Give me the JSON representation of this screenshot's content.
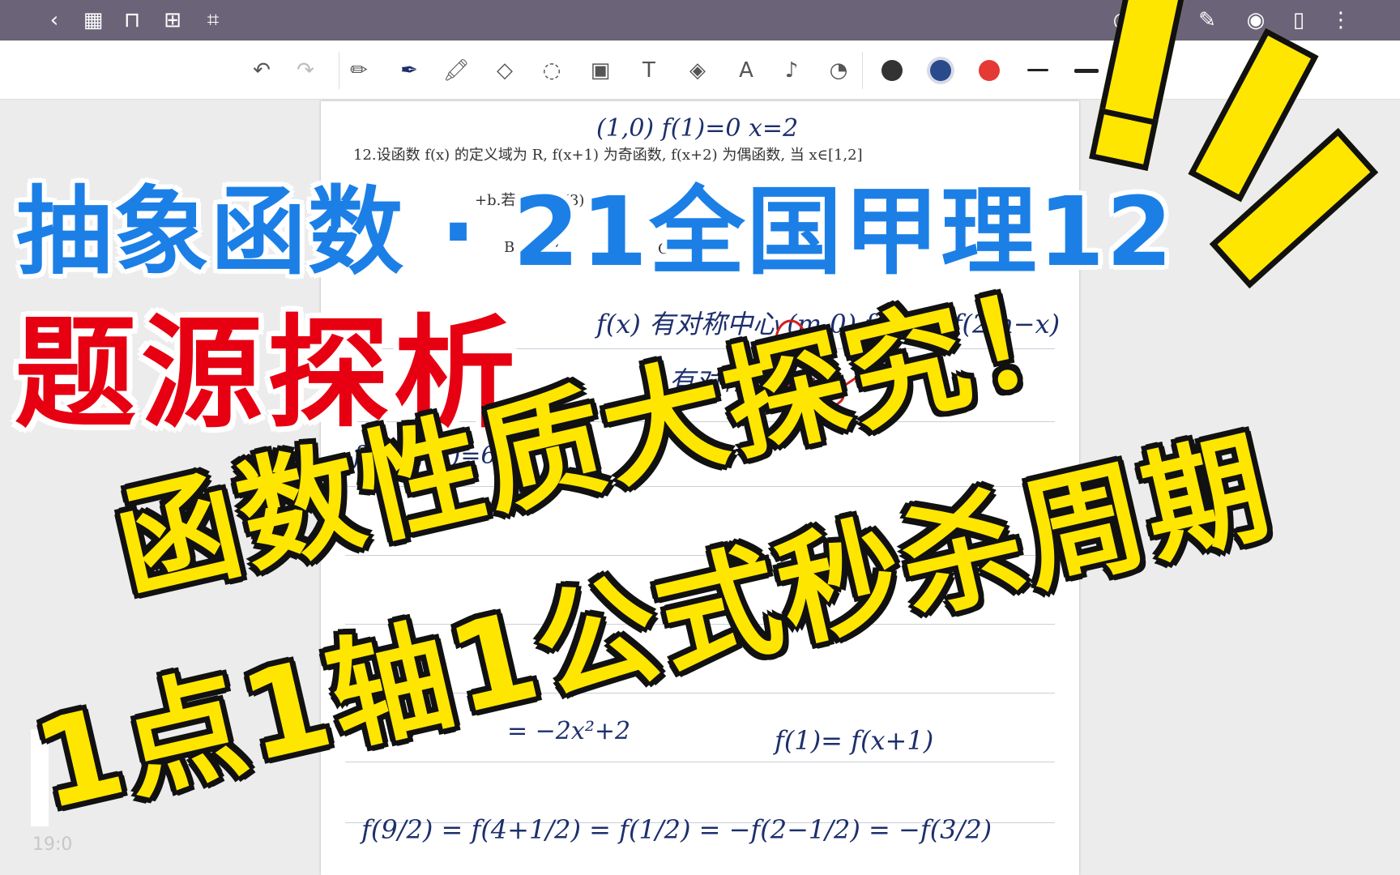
{
  "topbar": {
    "icons": [
      "back-icon",
      "grid-icon",
      "bookmark-icon",
      "add-page-icon",
      "crop-icon",
      "search-icon",
      "pen-settings-icon",
      "eye-icon",
      "page-layout-icon",
      "more-icon"
    ]
  },
  "toolbar": {
    "tools": [
      "undo-icon",
      "redo-icon",
      "pencil-icon",
      "pen-icon",
      "highlighter-icon",
      "eraser-icon",
      "lasso-icon",
      "image-icon",
      "text-icon",
      "shape-icon",
      "text-recognition-icon",
      "microphone-icon",
      "sticker-icon"
    ],
    "colors": [
      "#333333",
      "#2b4a8b",
      "#e53935"
    ]
  },
  "document": {
    "problem_line1": "12.设函数 f(x) 的定义域为 R, f(x+1) 为奇函数, f(x+2) 为偶函数, 当 x∈[1,2]",
    "problem_line2": "+b.若 f(0)+f(3)",
    "option_b": "B. −3/2",
    "option_c": "C.",
    "hand_top": "(1,0)  f(1)=0    x=2",
    "hand_sym_center": "f(x) 有对称中心 (m,0)   f(x)=−f(2m−x)",
    "hand_sym_axis": "有对称轴 x=2",
    "hand_sum": "f(0)+f(3)=6",
    "hand_mid": "= −2x²+2",
    "hand_eq": "f(1)= f(x+1)",
    "hand_bottom": "f(9/2) = f(4+1/2) = f(1/2) = −f(2−1/2) = −f(3/2)"
  },
  "overlay": {
    "title_blue": "抽象函数 · 21全国甲理12",
    "title_red": "题源探析",
    "headline_1": "函数性质大探究！",
    "headline_2": "1点1轴1公式秒杀周期"
  },
  "time": "19:0"
}
